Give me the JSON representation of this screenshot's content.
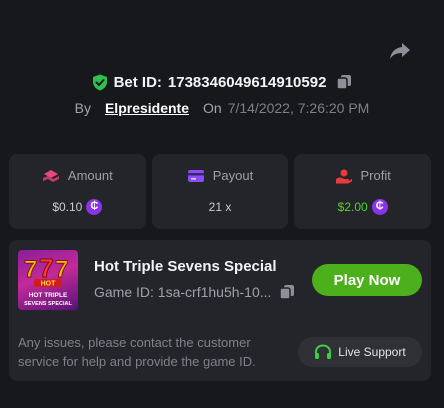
{
  "bet": {
    "label": "Bet ID:",
    "id": "1738346049614910592"
  },
  "byline": {
    "by": "By",
    "user": "Elpresidente",
    "on": "On",
    "date": "7/14/2022, 7:26:20 PM"
  },
  "stats": {
    "amount_label": "Amount",
    "amount_value": "$0.10",
    "payout_label": "Payout",
    "payout_value": "21 x",
    "profit_label": "Profit",
    "profit_value": "$2.00",
    "coin_symbol": "₵"
  },
  "game": {
    "title": "Hot Triple Sevens Special",
    "id_text": "Game ID: 1sa-crf1hu5h-10...",
    "play_label": "Play Now",
    "notice": "Any issues, please contact the customer service for help and provide the game ID.",
    "support_label": "Live Support",
    "thumb_logo": "HOT",
    "thumb_caption_1": "HOT TRIPLE",
    "thumb_caption_2": "SEVENS SPECIAL"
  },
  "colors": {
    "background": "#17181b",
    "card": "#23252a",
    "play_green": "#4caf1c",
    "profit_green": "#56d12a",
    "coin_purple": "#8b33e8",
    "shield_green": "#2fbf4f"
  },
  "icons": [
    "share-icon",
    "shield-check-icon",
    "copy-icon",
    "amount-icon",
    "payout-card-icon",
    "profit-icon",
    "coin-icon",
    "headset-icon"
  ]
}
